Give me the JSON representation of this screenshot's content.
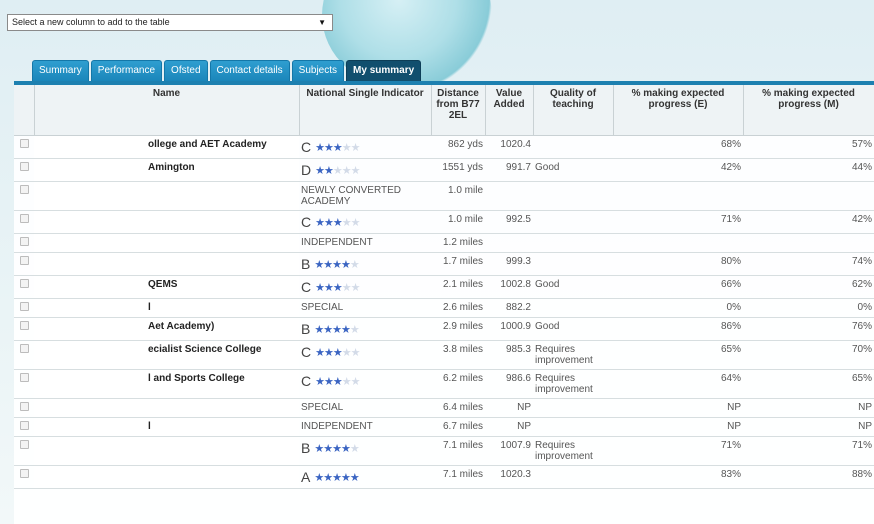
{
  "column_picker": {
    "label": "Select a new column to add to the table",
    "arrow": "▼"
  },
  "tabs": [
    "Summary",
    "Performance",
    "Ofsted",
    "Contact details",
    "Subjects",
    "My summary"
  ],
  "active_tab": "My summary",
  "headers": {
    "name": "Name",
    "nsi": "National Single Indicator",
    "distance": "Distance from B77 2EL",
    "va": "Value Added",
    "quality": "Quality of teaching",
    "pct_e": "% making expected progress (E)",
    "pct_m": "% making expected progress (M)"
  },
  "rows": [
    {
      "name": "ollege and AET Academy",
      "grade": "C",
      "stars": 3,
      "nsi": "",
      "distance": "862 yds",
      "va": "1020.4",
      "quality": "",
      "pct_e": "68%",
      "pct_m": "57%"
    },
    {
      "name": "Amington",
      "grade": "D",
      "stars": 2,
      "nsi": "",
      "distance": "1551 yds",
      "va": "991.7",
      "quality": "Good",
      "pct_e": "42%",
      "pct_m": "44%"
    },
    {
      "name": "",
      "grade": "",
      "stars": 0,
      "nsi": "NEWLY CONVERTED ACADEMY",
      "distance": "1.0 mile",
      "va": "",
      "quality": "",
      "pct_e": "",
      "pct_m": ""
    },
    {
      "name": "",
      "grade": "C",
      "stars": 3,
      "nsi": "",
      "distance": "1.0 mile",
      "va": "992.5",
      "quality": "",
      "pct_e": "71%",
      "pct_m": "42%"
    },
    {
      "name": "",
      "grade": "",
      "stars": 0,
      "nsi": "INDEPENDENT",
      "distance": "1.2 miles",
      "va": "",
      "quality": "",
      "pct_e": "",
      "pct_m": ""
    },
    {
      "name": "",
      "grade": "B",
      "stars": 4,
      "nsi": "",
      "distance": "1.7 miles",
      "va": "999.3",
      "quality": "",
      "pct_e": "80%",
      "pct_m": "74%"
    },
    {
      "name": "QEMS",
      "grade": "C",
      "stars": 3,
      "nsi": "",
      "distance": "2.1 miles",
      "va": "1002.8",
      "quality": "Good",
      "pct_e": "66%",
      "pct_m": "62%"
    },
    {
      "name": "l",
      "grade": "",
      "stars": 0,
      "nsi": "SPECIAL",
      "distance": "2.6 miles",
      "va": "882.2",
      "quality": "",
      "pct_e": "0%",
      "pct_m": "0%"
    },
    {
      "name": "Aet Academy)",
      "grade": "B",
      "stars": 4,
      "nsi": "",
      "distance": "2.9 miles",
      "va": "1000.9",
      "quality": "Good",
      "pct_e": "86%",
      "pct_m": "76%"
    },
    {
      "name": "ecialist Science College",
      "grade": "C",
      "stars": 3,
      "nsi": "",
      "distance": "3.8 miles",
      "va": "985.3",
      "quality": "Requires improvement",
      "pct_e": "65%",
      "pct_m": "70%"
    },
    {
      "name": "l and Sports College",
      "grade": "C",
      "stars": 3,
      "nsi": "",
      "distance": "6.2 miles",
      "va": "986.6",
      "quality": "Requires improvement",
      "pct_e": "64%",
      "pct_m": "65%"
    },
    {
      "name": "",
      "grade": "",
      "stars": 0,
      "nsi": "SPECIAL",
      "distance": "6.4 miles",
      "va": "NP",
      "quality": "",
      "pct_e": "NP",
      "pct_m": "NP"
    },
    {
      "name": "l",
      "grade": "",
      "stars": 0,
      "nsi": "INDEPENDENT",
      "distance": "6.7 miles",
      "va": "NP",
      "quality": "",
      "pct_e": "NP",
      "pct_m": "NP"
    },
    {
      "name": "",
      "grade": "B",
      "stars": 4,
      "nsi": "",
      "distance": "7.1 miles",
      "va": "1007.9",
      "quality": "Requires improvement",
      "pct_e": "71%",
      "pct_m": "71%"
    },
    {
      "name": "",
      "grade": "A",
      "stars": 5,
      "nsi": "",
      "distance": "7.1 miles",
      "va": "1020.3",
      "quality": "",
      "pct_e": "83%",
      "pct_m": "88%"
    }
  ],
  "colors": {
    "star_on": "#3a64c2",
    "star_off": "#d3dbe8",
    "tab": "#1b86ba",
    "tab_active": "#114f6e"
  }
}
